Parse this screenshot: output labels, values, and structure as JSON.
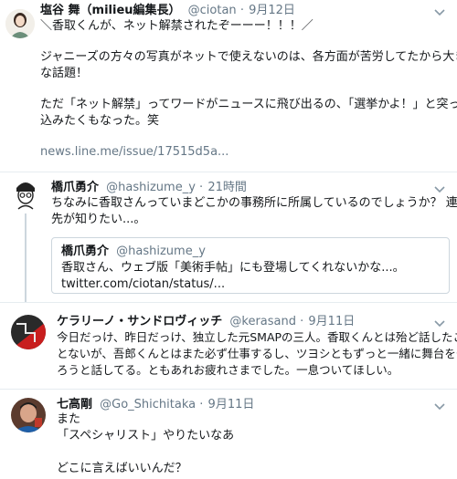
{
  "tweets": [
    {
      "name": "塩谷 舞（milieu編集長）",
      "handle": "@ciotan",
      "dot": "·",
      "time": "9月12日",
      "lines": [
        "＼香取くんが、ネット解禁されたぞーーー！！！／",
        "",
        "ジャニーズの方々の写真がネットで使えないのは、各方面が苦労してたから大き",
        "な話題！",
        "",
        "ただ「ネット解禁」ってワードがニュースに飛び出るの、「選挙かよ！」と突っ",
        "込みたくもなった。笑",
        ""
      ],
      "link": "news.line.me/issue/17515d5a..."
    },
    {
      "name": "橋爪勇介",
      "handle": "@hashizume_y",
      "dot": "·",
      "time": "21時間",
      "lines": [
        "ちなみに香取さんっていまどこかの事務所に所属しているのでしょうか？ 連絡",
        "先が知りたい...。"
      ],
      "quote": {
        "name": "橋爪勇介",
        "handle": "@hashizume_y",
        "text": "香取さん、ウェブ版「美術手帖」にも登場してくれないかな...。",
        "link": "twitter.com/ciotan/status/..."
      }
    },
    {
      "name": "ケラリーノ・サンドロヴィッチ",
      "handle": "@kerasand",
      "dot": "·",
      "time": "9月11日",
      "lines": [
        "今日だっけ、昨日だっけ、独立した元SMAPの三人。香取くんとは殆ど話したこ",
        "とないが、吾郎くんとはまた必ず仕事するし、ツヨシともずっと一緒に舞台をや",
        "ろうと話してる。ともあれお疲れさまでした。一息ついてほしい。"
      ]
    },
    {
      "name": "七高剛",
      "handle": "@Go_Shichitaka",
      "dot": "·",
      "time": "9月11日",
      "lines": [
        "また",
        "「スペシャリスト」やりたいなあ",
        "",
        "どこに言えばいいんだ？"
      ]
    }
  ],
  "colors": {
    "name": "#14171a",
    "meta": "#657786",
    "border": "#e6ecf0",
    "quote_border": "#ccd6dd"
  },
  "icons": [
    "chevron-down-icon",
    "avatar"
  ]
}
